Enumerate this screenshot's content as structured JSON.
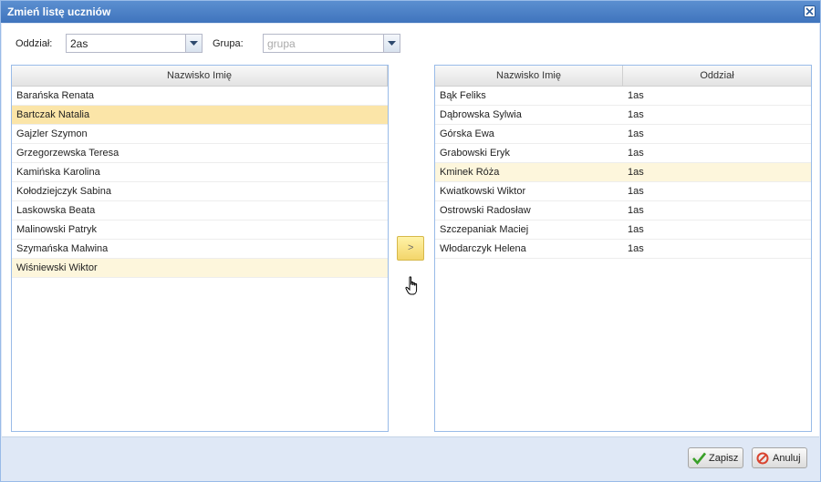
{
  "window": {
    "title": "Zmień listę uczniów"
  },
  "filters": {
    "oddzial_label": "Oddział:",
    "oddzial_value": "2as",
    "grupa_label": "Grupa:",
    "grupa_placeholder": "grupa"
  },
  "left_grid": {
    "header": "Nazwisko Imię",
    "rows": [
      {
        "name": "Barańska Renata"
      },
      {
        "name": "Bartczak Natalia",
        "state": "selected"
      },
      {
        "name": "Gajzler Szymon"
      },
      {
        "name": "Grzegorzewska Teresa"
      },
      {
        "name": "Kamińska Karolina"
      },
      {
        "name": "Kołodziejczyk Sabina"
      },
      {
        "name": "Laskowska Beata"
      },
      {
        "name": "Malinowski Patryk"
      },
      {
        "name": "Szymańska Malwina"
      },
      {
        "name": "Wiśniewski Wiktor",
        "state": "hover"
      }
    ]
  },
  "move_button": {
    "label": ">"
  },
  "right_grid": {
    "headers": [
      "Nazwisko Imię",
      "Oddział"
    ],
    "rows": [
      {
        "name": "Bąk Feliks",
        "class": "1as"
      },
      {
        "name": "Dąbrowska Sylwia",
        "class": "1as"
      },
      {
        "name": "Górska Ewa",
        "class": "1as"
      },
      {
        "name": "Grabowski Eryk",
        "class": "1as"
      },
      {
        "name": "Kminek Róża",
        "class": "1as",
        "state": "hover"
      },
      {
        "name": "Kwiatkowski Wiktor",
        "class": "1as"
      },
      {
        "name": "Ostrowski Radosław",
        "class": "1as"
      },
      {
        "name": "Szczepaniak Maciej",
        "class": "1as"
      },
      {
        "name": "Włodarczyk Helena",
        "class": "1as"
      }
    ]
  },
  "footer": {
    "save_label": "Zapisz",
    "cancel_label": "Anuluj"
  },
  "icons": {
    "close": "close-icon",
    "dropdown": "chevron-down-icon",
    "save": "checkmark-icon",
    "cancel": "cancel-icon",
    "cursor": "hand-cursor-icon"
  },
  "colors": {
    "titlebar": "#4a80c6",
    "selected_row": "#fbe5a8",
    "hover_row": "#fdf6dc",
    "move_button": "#f3d56a"
  }
}
